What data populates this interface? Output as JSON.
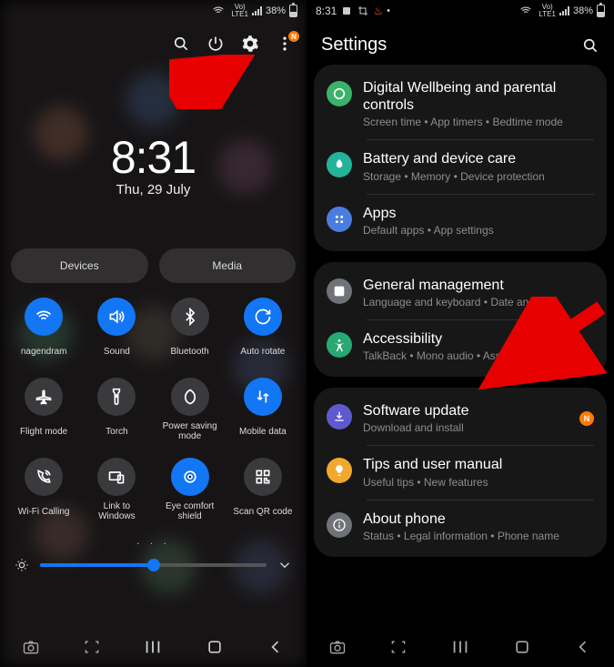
{
  "left": {
    "status": {
      "battery": "38%"
    },
    "clock": {
      "time": "8:31",
      "date": "Thu, 29 July"
    },
    "pills": {
      "devices": "Devices",
      "media": "Media"
    },
    "tiles": [
      [
        {
          "label": "nagendram",
          "on": true,
          "icon": "wifi"
        },
        {
          "label": "Sound",
          "on": true,
          "icon": "sound"
        },
        {
          "label": "Bluetooth",
          "on": false,
          "icon": "bluetooth"
        },
        {
          "label": "Auto rotate",
          "on": true,
          "icon": "rotate"
        }
      ],
      [
        {
          "label": "Flight mode",
          "on": false,
          "icon": "plane"
        },
        {
          "label": "Torch",
          "on": false,
          "icon": "torch"
        },
        {
          "label": "Power saving mode",
          "on": false,
          "icon": "leaf"
        },
        {
          "label": "Mobile data",
          "on": true,
          "icon": "data"
        }
      ],
      [
        {
          "label": "Wi-Fi Calling",
          "on": false,
          "icon": "wificall"
        },
        {
          "label": "Link to Windows",
          "on": false,
          "icon": "link"
        },
        {
          "label": "Eye comfort shield",
          "on": true,
          "icon": "eye"
        },
        {
          "label": "Scan QR code",
          "on": false,
          "icon": "qr"
        }
      ]
    ],
    "pager": ". . .",
    "brightness_percent": 50
  },
  "right": {
    "status": {
      "time": "8:31",
      "battery": "38%"
    },
    "header": "Settings",
    "groups": [
      [
        {
          "title": "Digital Wellbeing and parental controls",
          "sub": "Screen time  •  App timers  •  Bedtime mode",
          "color": "#39b36a",
          "icon": "wellbeing"
        },
        {
          "title": "Battery and device care",
          "sub": "Storage  •  Memory  •  Device protection",
          "color": "#22b39a",
          "icon": "care"
        },
        {
          "title": "Apps",
          "sub": "Default apps  •  App settings",
          "color": "#4a7de0",
          "icon": "apps"
        }
      ],
      [
        {
          "title": "General management",
          "sub": "Language and keyboard  •  Date and time",
          "color": "#6f7277",
          "icon": "general"
        },
        {
          "title": "Accessibility",
          "sub": "TalkBack  •  Mono audio  •  Assistant menu",
          "color": "#28a974",
          "icon": "a11y"
        }
      ],
      [
        {
          "title": "Software update",
          "sub": "Download and install",
          "color": "#5f59cf",
          "icon": "update",
          "badge": "N"
        },
        {
          "title": "Tips and user manual",
          "sub": "Useful tips  •  New features",
          "color": "#f2a72e",
          "icon": "tips"
        },
        {
          "title": "About phone",
          "sub": "Status  •  Legal information  •  Phone name",
          "color": "#6f7277",
          "icon": "about"
        }
      ]
    ]
  }
}
